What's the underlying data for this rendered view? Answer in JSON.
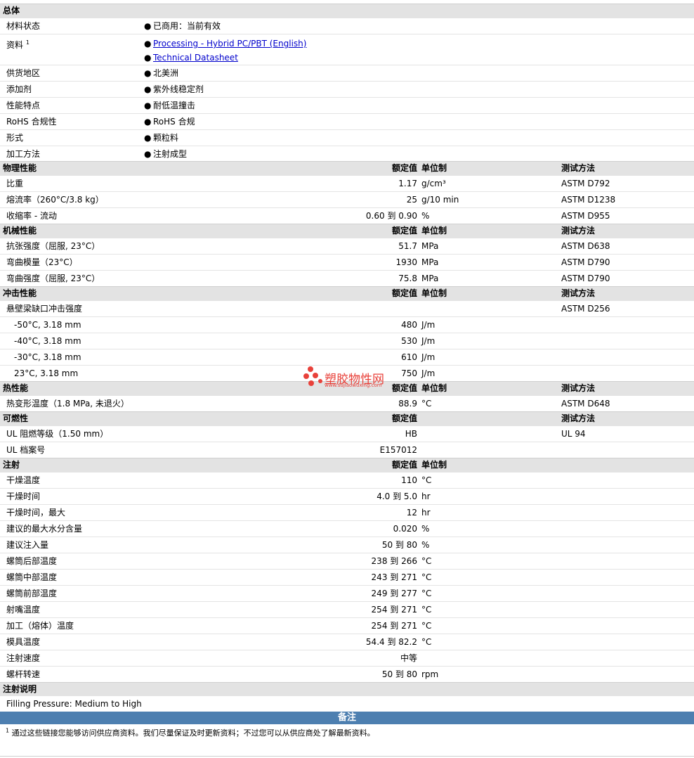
{
  "general": {
    "title": "总体",
    "rows": [
      {
        "label": "材料状态",
        "items": [
          "已商用：当前有效"
        ]
      },
      {
        "label": "资料",
        "sup": "1",
        "links": [
          "Processing - Hybrid PC/PBT (English)",
          "Technical Datasheet"
        ]
      },
      {
        "label": "供货地区",
        "items": [
          "北美洲"
        ]
      },
      {
        "label": "添加剂",
        "items": [
          "紫外线稳定剂"
        ]
      },
      {
        "label": "性能特点",
        "items": [
          "耐低温撞击"
        ]
      },
      {
        "label": "RoHS 合规性",
        "items": [
          "RoHS 合规"
        ]
      },
      {
        "label": "形式",
        "items": [
          "颗粒料"
        ]
      },
      {
        "label": "加工方法",
        "items": [
          "注射成型"
        ]
      }
    ]
  },
  "headers": {
    "value": "额定值",
    "unit": "单位制",
    "test": "测试方法"
  },
  "physical": {
    "title": "物理性能",
    "rows": [
      {
        "label": "比重",
        "value": "1.17",
        "unit": "g/cm³",
        "test": "ASTM D792"
      },
      {
        "label": "熔流率（260°C/3.8 kg）",
        "value": "25",
        "unit": "g/10 min",
        "test": "ASTM D1238"
      },
      {
        "label": "收缩率 - 流动",
        "value": "0.60 到 0.90",
        "unit": "%",
        "test": "ASTM D955"
      }
    ]
  },
  "mechanical": {
    "title": "机械性能",
    "rows": [
      {
        "label": "抗张强度（屈服, 23°C）",
        "value": "51.7",
        "unit": "MPa",
        "test": "ASTM D638"
      },
      {
        "label": "弯曲模量（23°C）",
        "value": "1930",
        "unit": "MPa",
        "test": "ASTM D790"
      },
      {
        "label": "弯曲强度（屈服, 23°C）",
        "value": "75.8",
        "unit": "MPa",
        "test": "ASTM D790"
      }
    ]
  },
  "impact": {
    "title": "冲击性能",
    "rows": [
      {
        "label": "悬壁梁缺口冲击强度",
        "value": "",
        "unit": "",
        "test": "ASTM D256"
      },
      {
        "label": "-50°C, 3.18 mm",
        "value": "480",
        "unit": "J/m",
        "test": ""
      },
      {
        "label": "-40°C, 3.18 mm",
        "value": "530",
        "unit": "J/m",
        "test": ""
      },
      {
        "label": "-30°C, 3.18 mm",
        "value": "610",
        "unit": "J/m",
        "test": ""
      },
      {
        "label": "23°C, 3.18 mm",
        "value": "750",
        "unit": "J/m",
        "test": ""
      }
    ]
  },
  "thermal": {
    "title": "热性能",
    "rows": [
      {
        "label": "热变形温度（1.8 MPa, 未退火）",
        "value": "88.9",
        "unit": "°C",
        "test": "ASTM D648"
      }
    ]
  },
  "flammability": {
    "title": "可燃性",
    "rows": [
      {
        "label": "UL 阻燃等级（1.50 mm）",
        "value": "HB",
        "unit": "",
        "test": "UL 94"
      },
      {
        "label": "UL 档案号",
        "value": "E157012",
        "unit": "",
        "test": ""
      }
    ]
  },
  "injection": {
    "title": "注射",
    "rows": [
      {
        "label": "干燥温度",
        "value": "110",
        "unit": "°C"
      },
      {
        "label": "干燥时间",
        "value": "4.0 到 5.0",
        "unit": "hr"
      },
      {
        "label": "干燥时间，最大",
        "value": "12",
        "unit": "hr"
      },
      {
        "label": "建议的最大水分含量",
        "value": "0.020",
        "unit": "%"
      },
      {
        "label": "建议注入量",
        "value": "50 到 80",
        "unit": "%"
      },
      {
        "label": "螺筒后部温度",
        "value": "238 到 266",
        "unit": "°C"
      },
      {
        "label": "螺筒中部温度",
        "value": "243 到 271",
        "unit": "°C"
      },
      {
        "label": "螺筒前部温度",
        "value": "249 到 277",
        "unit": "°C"
      },
      {
        "label": "射嘴温度",
        "value": "254 到 271",
        "unit": "°C"
      },
      {
        "label": "加工（熔体）温度",
        "value": "254 到 271",
        "unit": "°C"
      },
      {
        "label": "模具温度",
        "value": "54.4 到 82.2",
        "unit": "°C"
      },
      {
        "label": "注射速度",
        "value": "中等",
        "unit": ""
      },
      {
        "label": "螺杆转速",
        "value": "50 到 80",
        "unit": "rpm"
      }
    ]
  },
  "injection_notes": {
    "title": "注射说明",
    "text": "Filling Pressure: Medium to High"
  },
  "notes": {
    "banner": "备注",
    "sup": "1",
    "footnote": "通过这些链接您能够访问供应商资料。我们尽量保证及时更新资料；不过您可以从供应商处了解最新资料。"
  },
  "watermark": {
    "text": "塑胶物性网",
    "url": "www.sujiaowuxing.com"
  },
  "colors": {
    "section_bg": "#e3e3e3",
    "banner_bg": "#4d7fb0",
    "link": "#0000cc",
    "watermark": "#e8413a"
  }
}
